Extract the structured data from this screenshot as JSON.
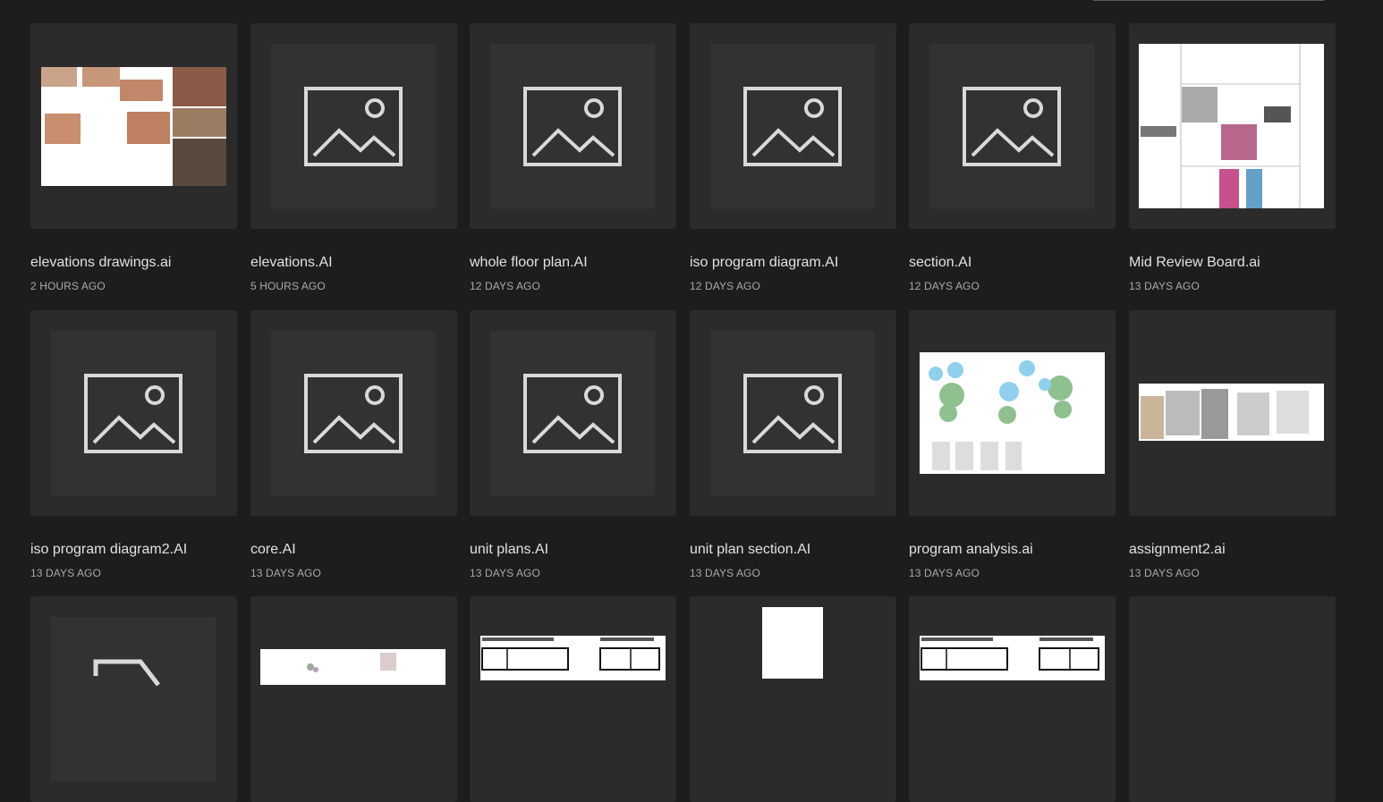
{
  "files": [
    {
      "name": "elevations drawings.ai",
      "modified": "2 HOURS AGO",
      "thumbnail": "preview"
    },
    {
      "name": "elevations.AI",
      "modified": "5 HOURS AGO",
      "thumbnail": "placeholder"
    },
    {
      "name": "whole floor plan.AI",
      "modified": "12 DAYS AGO",
      "thumbnail": "placeholder"
    },
    {
      "name": "iso program diagram.AI",
      "modified": "12 DAYS AGO",
      "thumbnail": "placeholder"
    },
    {
      "name": "section.AI",
      "modified": "12 DAYS AGO",
      "thumbnail": "placeholder"
    },
    {
      "name": "Mid Review Board.ai",
      "modified": "13 DAYS AGO",
      "thumbnail": "preview"
    },
    {
      "name": "iso program diagram2.AI",
      "modified": "13 DAYS AGO",
      "thumbnail": "placeholder"
    },
    {
      "name": "core.AI",
      "modified": "13 DAYS AGO",
      "thumbnail": "placeholder"
    },
    {
      "name": "unit plans.AI",
      "modified": "13 DAYS AGO",
      "thumbnail": "placeholder"
    },
    {
      "name": "unit plan section.AI",
      "modified": "13 DAYS AGO",
      "thumbnail": "placeholder"
    },
    {
      "name": "program analysis.ai",
      "modified": "13 DAYS AGO",
      "thumbnail": "preview"
    },
    {
      "name": "assignment2.ai",
      "modified": "13 DAYS AGO",
      "thumbnail": "preview"
    }
  ],
  "colors": {
    "background": "#1d1d1d",
    "card": "#2b2b2b",
    "placeholder": "#323232",
    "icon_stroke": "#d9d9d9",
    "name_text": "#e2e2e2",
    "time_text": "#a9a9a9"
  },
  "icons": {
    "placeholder": "image-placeholder-icon",
    "partial": "file-icon"
  }
}
